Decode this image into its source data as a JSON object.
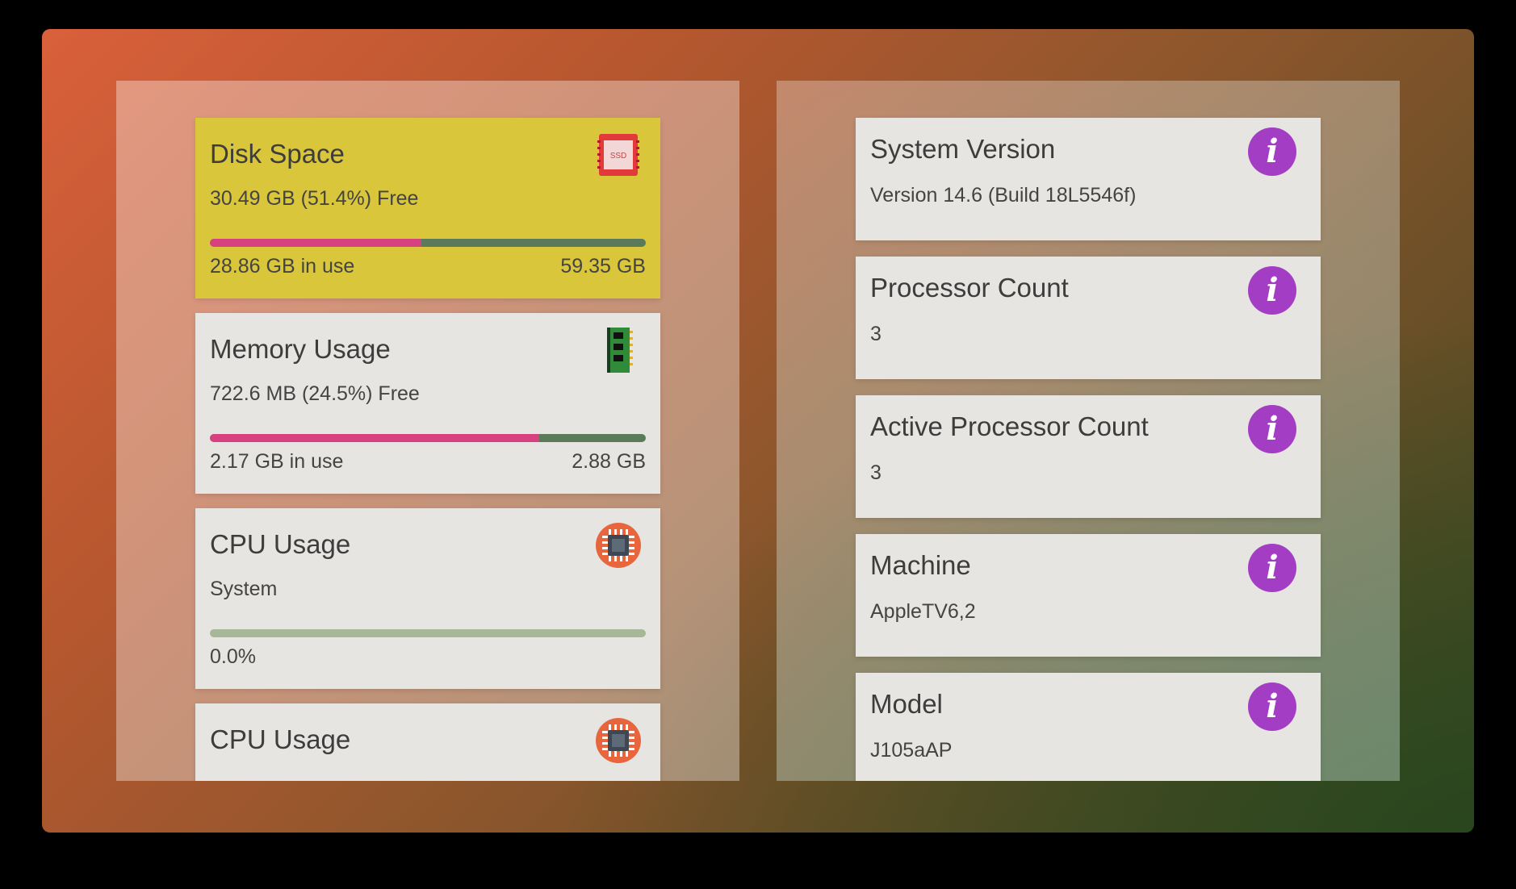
{
  "left_panel": {
    "cards": [
      {
        "title": "Disk Space",
        "subtitle": "30.49 GB (51.4%) Free",
        "used_label": "28.86 GB in use",
        "total_label": "59.35 GB",
        "used_fraction": 0.486,
        "icon": "ssd-icon"
      },
      {
        "title": "Memory Usage",
        "subtitle": "722.6 MB (24.5%) Free",
        "used_label": "2.17 GB in use",
        "total_label": "2.88 GB",
        "used_fraction": 0.755,
        "icon": "ram-module-icon"
      },
      {
        "title": "CPU Usage",
        "subtitle": "System",
        "used_label": "0.0%",
        "used_fraction": 0.0,
        "icon": "cpu-chip-icon"
      },
      {
        "title": "CPU Usage",
        "icon": "cpu-chip-icon"
      }
    ]
  },
  "right_panel": {
    "items": [
      {
        "title": "System Version",
        "value": "Version 14.6 (Build 18L5546f)",
        "icon": "info-icon"
      },
      {
        "title": "Processor Count",
        "value": "3",
        "icon": "info-icon"
      },
      {
        "title": "Active Processor Count",
        "value": "3",
        "icon": "info-icon"
      },
      {
        "title": "Machine",
        "value": "AppleTV6,2",
        "icon": "info-icon"
      },
      {
        "title": "Model",
        "value": "J105aAP",
        "icon": "info-icon"
      }
    ],
    "info_glyph": "i"
  },
  "colors": {
    "disk_card": "#d9c63a",
    "bar_used": "#d7417f",
    "bar_free": "#5b7a5a",
    "info_icon": "#a33ec4",
    "focus_strip": "#1d7cf2"
  }
}
